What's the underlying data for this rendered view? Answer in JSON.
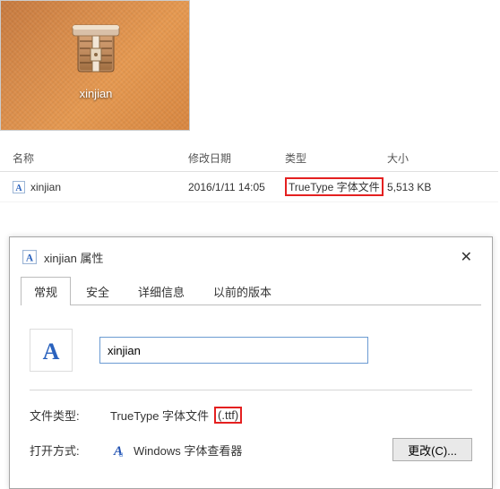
{
  "desktop": {
    "icon_label": "xinjian"
  },
  "filelist": {
    "headers": {
      "name": "名称",
      "date": "修改日期",
      "type": "类型",
      "size": "大小"
    },
    "row": {
      "name": "xinjian",
      "date": "2016/1/11 14:05",
      "type": "TrueType 字体文件",
      "size": "5,513 KB"
    }
  },
  "dialog": {
    "title": "xinjian 属性",
    "close": "✕",
    "tabs": {
      "general": "常规",
      "security": "安全",
      "details": "详细信息",
      "previous": "以前的版本"
    },
    "filename": "xinjian",
    "filetype_label": "文件类型:",
    "filetype_value": "TrueType 字体文件 ",
    "filetype_ext": "(.ttf)",
    "openwith_label": "打开方式:",
    "openwith_value": "Windows 字体查看器",
    "change_btn": "更改(C)..."
  }
}
